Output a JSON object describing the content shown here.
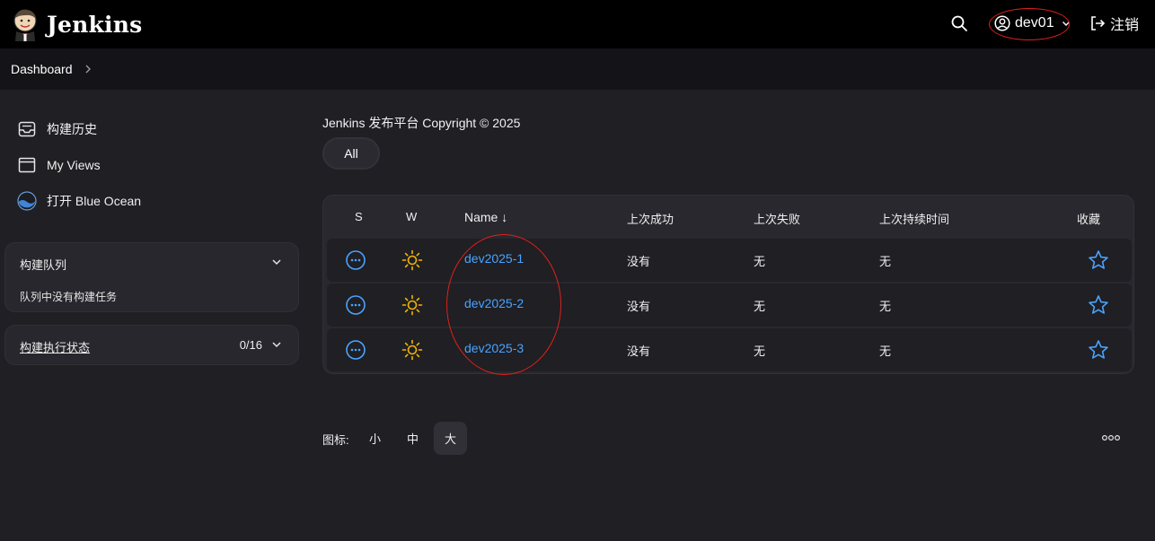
{
  "header": {
    "brand": "Jenkins",
    "user": "dev01",
    "logout_label": "注销"
  },
  "breadcrumb": {
    "items": [
      "Dashboard"
    ]
  },
  "sidebar": {
    "tasks": [
      {
        "label": "构建历史",
        "icon": "inbox-icon"
      },
      {
        "label": "My Views",
        "icon": "window-icon"
      },
      {
        "label": "打开 Blue Ocean",
        "icon": "blue-ocean-icon"
      }
    ],
    "build_queue": {
      "title": "构建队列",
      "empty_text": "队列中没有构建任务"
    },
    "executors": {
      "title": "构建执行状态",
      "count": "0/16"
    }
  },
  "main": {
    "description": "Jenkins 发布平台 Copyright © 2025",
    "tabs": [
      {
        "label": "All",
        "active": true
      }
    ],
    "table": {
      "headers": {
        "s": "S",
        "w": "W",
        "name": "Name ↓",
        "last_success": "上次成功",
        "last_failure": "上次失败",
        "last_duration": "上次持续时间",
        "favorite": "收藏"
      },
      "rows": [
        {
          "name": "dev2025-1",
          "last_success": "没有",
          "last_failure": "无",
          "last_duration": "无",
          "status_icon": "not-built-icon",
          "weather_icon": "sunny-icon"
        },
        {
          "name": "dev2025-2",
          "last_success": "没有",
          "last_failure": "无",
          "last_duration": "无",
          "status_icon": "not-built-icon",
          "weather_icon": "sunny-icon"
        },
        {
          "name": "dev2025-3",
          "last_success": "没有",
          "last_failure": "无",
          "last_duration": "无",
          "status_icon": "not-built-icon",
          "weather_icon": "sunny-icon"
        }
      ]
    },
    "icon_size": {
      "label": "图标:",
      "options": [
        "小",
        "中",
        "大"
      ],
      "selected": "大"
    }
  },
  "colors": {
    "header_bg": "#000000",
    "page_bg": "#1f1f24",
    "link": "#4aa3ff",
    "annotation_red": "#e0211b",
    "weather_yellow": "#f5b500"
  }
}
